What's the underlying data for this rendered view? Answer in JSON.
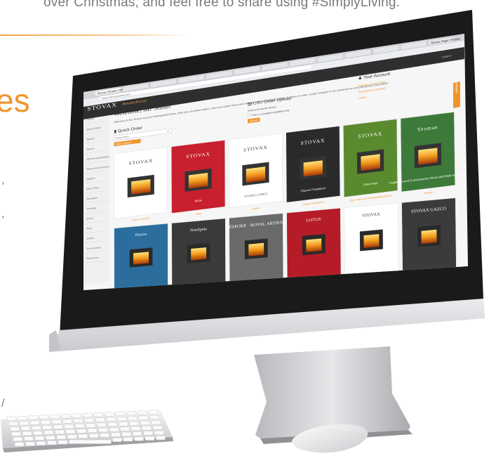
{
  "background": {
    "top_text": "over Christmas, and feel free to share using #SimplyLiving.",
    "side_fragment": "es",
    "side_marks": [
      ",",
      ",",
      "/"
    ],
    "accent_color": "#f0952e"
  },
  "browser": {
    "tabs": [
      "Stovax Retailer Portal",
      "",
      "",
      "",
      "",
      "",
      "",
      "",
      "",
      "",
      "",
      "",
      "Stovax Page | Stovax"
    ],
    "url": "www.stovaxportal.com"
  },
  "portal": {
    "logo": "STOVAX",
    "portal_name": "RetailerPortal",
    "header_right": "Logout",
    "welcome_title": "Welcome, Mr Smith",
    "welcome_text": "Welcome to the Stovax Account Management Area. Here you can place orders, view your order history and manage your account information. To place an order, simply navigate to your products by using the product links below.",
    "sidebar": [
      "Home",
      "Quick Order",
      "Stovax",
      "Gazco",
      "Stovax Accessories",
      "Gazco Accessories",
      "Spares",
      "Elise Fires",
      "Nordpeis",
      "Yeoman",
      "Dovre",
      "Riva",
      "Studio",
      "Accessories",
      "Brochures"
    ],
    "feedback_tab": "Feedback",
    "quick_order": {
      "title": "Quick Order",
      "select_placeholder": "Select Item",
      "button": "Add to Basket"
    },
    "csv_upload": {
      "title": "CSV Order Upload",
      "option_1": "Choose file  No file chosen",
      "option_2": "This is a complete Installation only",
      "button": "Upload"
    },
    "account": {
      "title": "Your Account",
      "links": [
        "Manage account details",
        "Change your password",
        "Logout"
      ]
    },
    "products_row1": [
      {
        "caption": "Stovax Stoves",
        "brand": "STOVAX",
        "color": "#ffffff"
      },
      {
        "caption": "Riva",
        "brand": "STOVAX",
        "sub": "RIVA",
        "color": "#c8202e"
      },
      {
        "caption": "Studio",
        "brand": "STOVAX",
        "sub": "STUDIO | FIRES",
        "color": "#ffffff"
      },
      {
        "caption": "Classic Fireplaces",
        "brand": "STOVAX",
        "sub": "Classic Fireplaces",
        "color": "#2a2a2a"
      },
      {
        "caption": "Elise Fires and Freestanding Stoves",
        "brand": "STOVAX",
        "sub": "Elise Fires",
        "color": "#5a8a2e"
      },
      {
        "caption": "Yeoman",
        "brand": "Yeoman",
        "sub": "Traditional and Contemporary Wood and Multi-fuel Stoves",
        "color": "#3d7a3a"
      }
    ],
    "products_row2": [
      {
        "brand": "Dovre",
        "color": "#2b6e9e"
      },
      {
        "brand": "Nordpeis",
        "color": "#3a3a3a"
      },
      {
        "brand": "BESPOKE · ROYAL ARTISAN",
        "color": "#6a6a6a"
      },
      {
        "brand": "LOTUS",
        "color": "#b51c28"
      },
      {
        "brand": "STOVAX",
        "color": "#ffffff"
      },
      {
        "brand": "STOVAX GAZCO",
        "color": "#3b3b3b"
      }
    ]
  }
}
